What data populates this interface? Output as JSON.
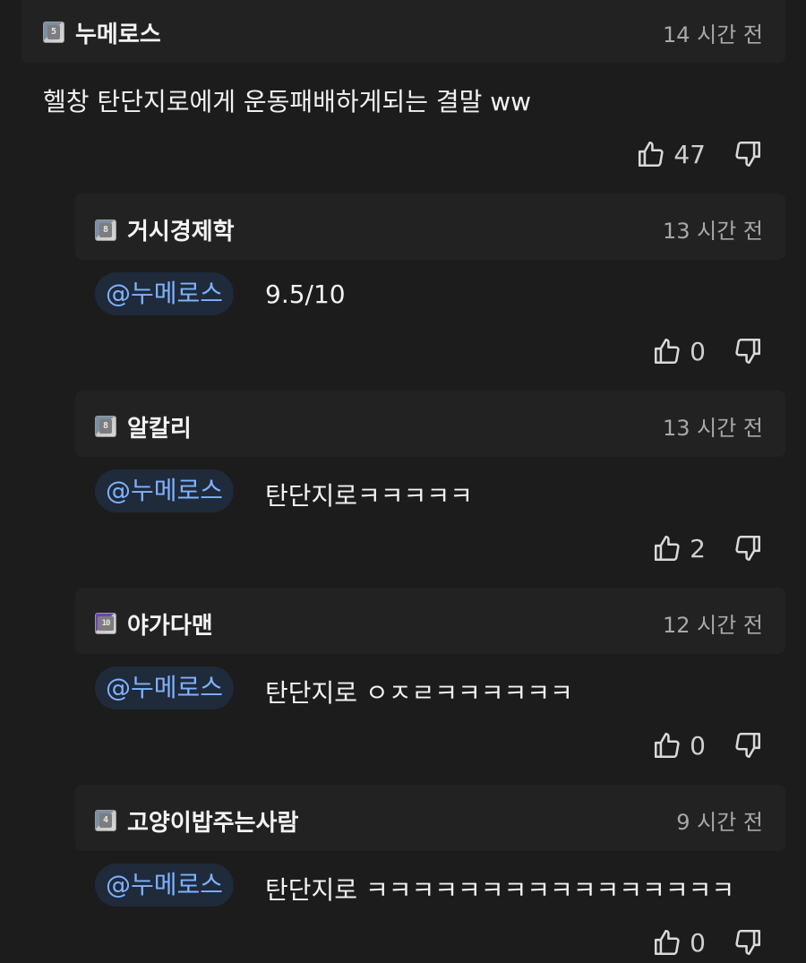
{
  "comments": [
    {
      "level": "5",
      "username": "누메로스",
      "time": "14 시간 전",
      "mention": "",
      "text": "헬창 탄단지로에게 운동패배하게되는 결말 ww",
      "likes": "47"
    },
    {
      "level": "8",
      "username": "거시경제학",
      "time": "13 시간 전",
      "mention": "@누메로스",
      "text": "9.5/10",
      "likes": "0"
    },
    {
      "level": "8",
      "username": "알칼리",
      "time": "13 시간 전",
      "mention": "@누메로스",
      "text": "탄단지로ㅋㅋㅋㅋㅋ",
      "likes": "2"
    },
    {
      "level": "10",
      "username": "야가다맨",
      "time": "12 시간 전",
      "mention": "@누메로스",
      "text": "탄단지로 ㅇㅈㄹㅋㅋㅋㅋㅋㅋ",
      "likes": "0"
    },
    {
      "level": "4",
      "username": "고양이밥주는사람",
      "time": "9 시간 전",
      "mention": "@누메로스",
      "text": "탄단지로 ㅋㅋㅋㅋㅋㅋㅋㅋㅋㅋㅋㅋㅋㅋㅋㅋ",
      "likes": "0"
    }
  ],
  "icons": {
    "like": "thumbs-up-icon",
    "dislike": "thumbs-down-icon",
    "level_badge": "level-badge-icon"
  },
  "colors": {
    "background": "#1c1c1c",
    "header_background": "#222222",
    "mention_text": "#7fb2ff",
    "mention_background": "#1f2a3a",
    "time_text": "#a8a8a8"
  }
}
